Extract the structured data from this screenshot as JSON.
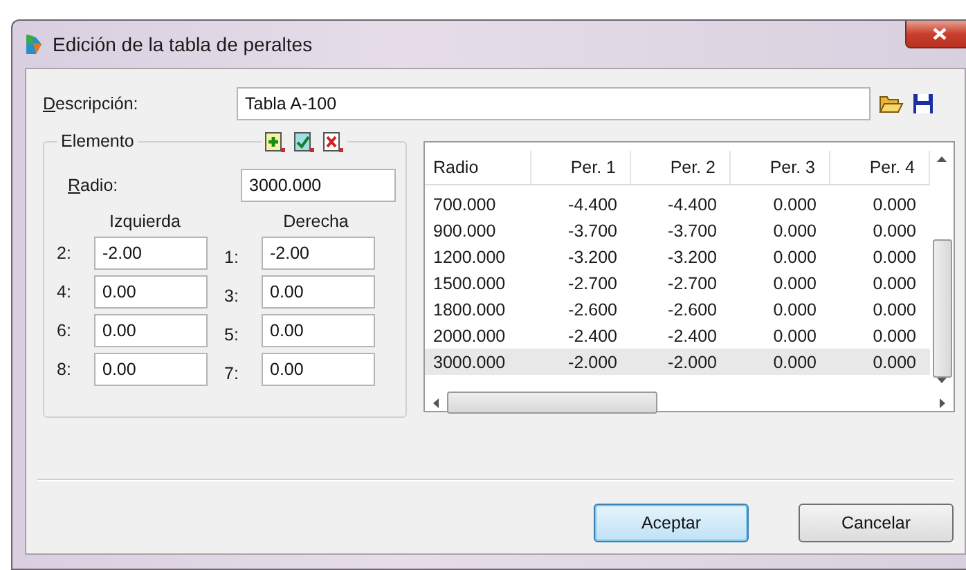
{
  "window": {
    "title": "Edición de la tabla de peraltes"
  },
  "description": {
    "label": "Descripción:",
    "value": "Tabla A-100"
  },
  "element": {
    "title": "Elemento",
    "radius_label": "Radio:",
    "radius_value": "3000.000",
    "left_heading": "Izquierda",
    "right_heading": "Derecha",
    "rows": [
      {
        "left_label": "2:",
        "left_value": "-2.00",
        "right_label": "1:",
        "right_value": "-2.00"
      },
      {
        "left_label": "4:",
        "left_value": "0.00",
        "right_label": "3:",
        "right_value": "0.00"
      },
      {
        "left_label": "6:",
        "left_value": "0.00",
        "right_label": "5:",
        "right_value": "0.00"
      },
      {
        "left_label": "8:",
        "left_value": "0.00",
        "right_label": "7:",
        "right_value": "0.00"
      }
    ]
  },
  "table": {
    "columns": [
      "Radio",
      "Per. 1",
      "Per. 2",
      "Per. 3",
      "Per. 4"
    ],
    "rows": [
      {
        "cells": [
          "700.000",
          "-4.400",
          "-4.400",
          "0.000",
          "0.000"
        ],
        "selected": false
      },
      {
        "cells": [
          "900.000",
          "-3.700",
          "-3.700",
          "0.000",
          "0.000"
        ],
        "selected": false
      },
      {
        "cells": [
          "1200.000",
          "-3.200",
          "-3.200",
          "0.000",
          "0.000"
        ],
        "selected": false
      },
      {
        "cells": [
          "1500.000",
          "-2.700",
          "-2.700",
          "0.000",
          "0.000"
        ],
        "selected": false
      },
      {
        "cells": [
          "1800.000",
          "-2.600",
          "-2.600",
          "0.000",
          "0.000"
        ],
        "selected": false
      },
      {
        "cells": [
          "2000.000",
          "-2.400",
          "-2.400",
          "0.000",
          "0.000"
        ],
        "selected": false
      },
      {
        "cells": [
          "3000.000",
          "-2.000",
          "-2.000",
          "0.000",
          "0.000"
        ],
        "selected": true
      }
    ]
  },
  "buttons": [
    {
      "label": "Aceptar",
      "default": true
    },
    {
      "label": "Cancelar",
      "default": false
    }
  ]
}
